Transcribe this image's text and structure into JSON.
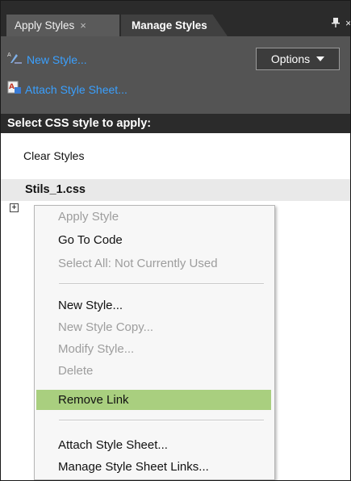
{
  "tabs": {
    "apply_styles": "Apply Styles",
    "manage_styles": "Manage Styles",
    "close_glyph": "×"
  },
  "toolbar": {
    "new_style": "New Style...",
    "attach_style_sheet": "Attach Style Sheet...",
    "options": "Options"
  },
  "section_header": "Select CSS style to apply:",
  "list": {
    "clear_styles": "Clear Styles",
    "stylesheet": "Stils_1.css",
    "expand_glyph": "+"
  },
  "context_menu": {
    "items": [
      {
        "label": "Apply Style",
        "enabled": false
      },
      {
        "label": "Go To Code",
        "enabled": true
      },
      {
        "label": "Select All: Not Currently Used",
        "enabled": false
      },
      {
        "label": "New Style...",
        "enabled": true
      },
      {
        "label": "New Style Copy...",
        "enabled": false
      },
      {
        "label": "Modify Style...",
        "enabled": false
      },
      {
        "label": "Delete",
        "enabled": false
      },
      {
        "label": "Remove Link",
        "enabled": true,
        "highlighted": true
      },
      {
        "label": "Attach Style Sheet...",
        "enabled": true
      },
      {
        "label": "Manage Style Sheet Links...",
        "enabled": true
      }
    ]
  },
  "colors": {
    "link_blue": "#3aa0ff",
    "highlight_green": "#a9cf7f",
    "panel_dark": "#2b2b2b",
    "toolbar_gray": "#545454"
  },
  "icons": {
    "new_style": "new-style-icon",
    "attach": "attach-style-sheet-icon",
    "pin": "pin-icon",
    "close": "close-icon"
  }
}
